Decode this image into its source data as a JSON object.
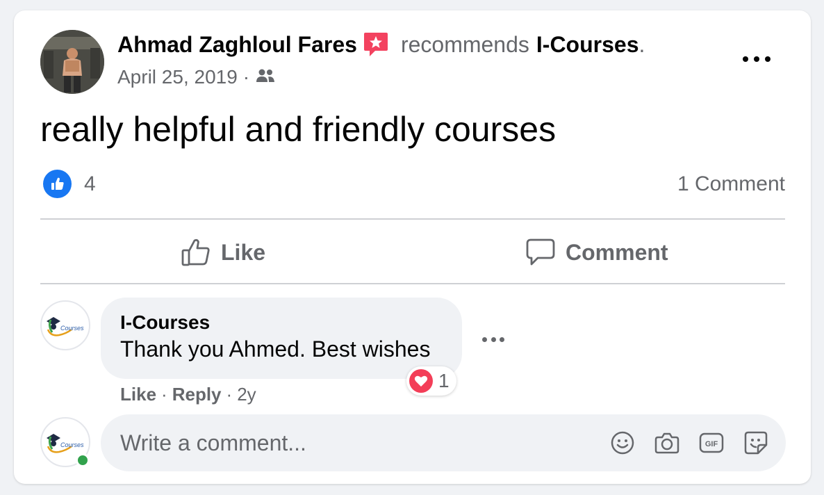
{
  "post": {
    "author_name": "Ahmad Zaghloul Fares",
    "recommends_text": "recommends",
    "page_name": "I-Courses",
    "period": ".",
    "date": "April 25, 2019",
    "meta_sep": "·",
    "audience_icon": "friends-icon",
    "more_icon": "more-horizontal-icon",
    "recommend_icon": "recommend-star-icon",
    "body": "really helpful and friendly courses"
  },
  "reactions": {
    "icon": "like-thumb-icon",
    "count": "4",
    "comment_count": "1 Comment",
    "color": "#1877f2"
  },
  "actions": {
    "like_label": "Like",
    "comment_label": "Comment"
  },
  "comment": {
    "author": "I-Courses",
    "text": "Thank you Ahmed. Best wishes",
    "reaction_icon": "heart-icon",
    "reaction_count": "1",
    "like_label": "Like",
    "reply_label": "Reply",
    "sep": "·",
    "age": "2y"
  },
  "composer": {
    "placeholder": "Write a comment...",
    "icons": [
      "emoji-icon",
      "camera-icon",
      "gif-icon",
      "sticker-icon"
    ],
    "online_color": "#31a24c"
  },
  "logo": {
    "text": "Courses"
  }
}
